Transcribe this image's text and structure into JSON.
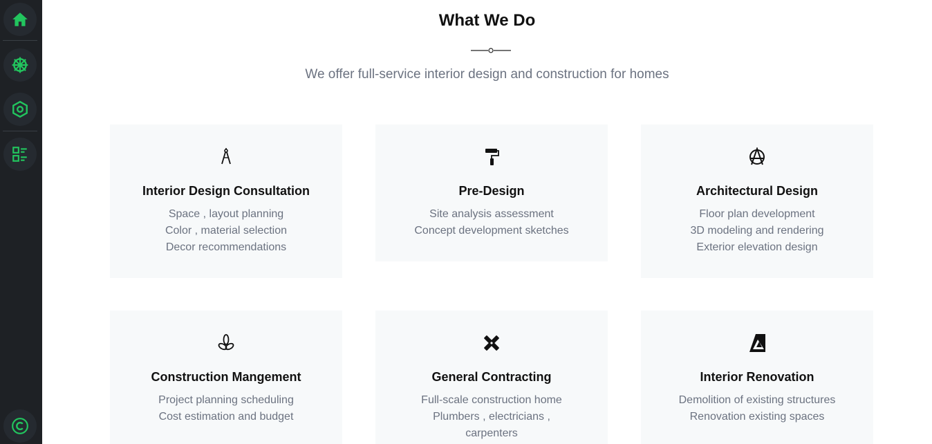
{
  "sidebar": {
    "items": [
      {
        "icon": "home-icon"
      },
      {
        "icon": "helm-icon"
      },
      {
        "icon": "hexagon-icon"
      },
      {
        "icon": "list-icon"
      },
      {
        "icon": "copyright-icon"
      }
    ],
    "accent": "#22c55e"
  },
  "section": {
    "title": "What We Do",
    "subtitle": "We offer full-service interior design and construction for homes"
  },
  "services": [
    {
      "icon": "compass-icon",
      "title": "Interior Design Consultation",
      "items": [
        "Space , layout planning",
        "Color , material selection",
        "Decor recommendations"
      ]
    },
    {
      "icon": "paint-roller-icon",
      "title": "Pre-Design",
      "items": [
        "Site analysis assessment",
        "Concept development sketches"
      ]
    },
    {
      "icon": "anarchy-icon",
      "title": "Architectural Design",
      "items": [
        "Floor plan development",
        "3D modeling and rendering",
        "Exterior elevation design"
      ]
    },
    {
      "icon": "trefoil-icon",
      "title": "Construction Mangement",
      "items": [
        "Project planning scheduling",
        "Cost estimation and budget"
      ]
    },
    {
      "icon": "pencil-ruler-icon",
      "title": "General Contracting",
      "items": [
        "Full-scale construction home",
        "Plumbers , electricians ,",
        "carpenters"
      ]
    },
    {
      "icon": "affinity-icon",
      "title": "Interior Renovation",
      "items": [
        "Demolition of existing structures",
        "Renovation existing spaces"
      ]
    }
  ]
}
